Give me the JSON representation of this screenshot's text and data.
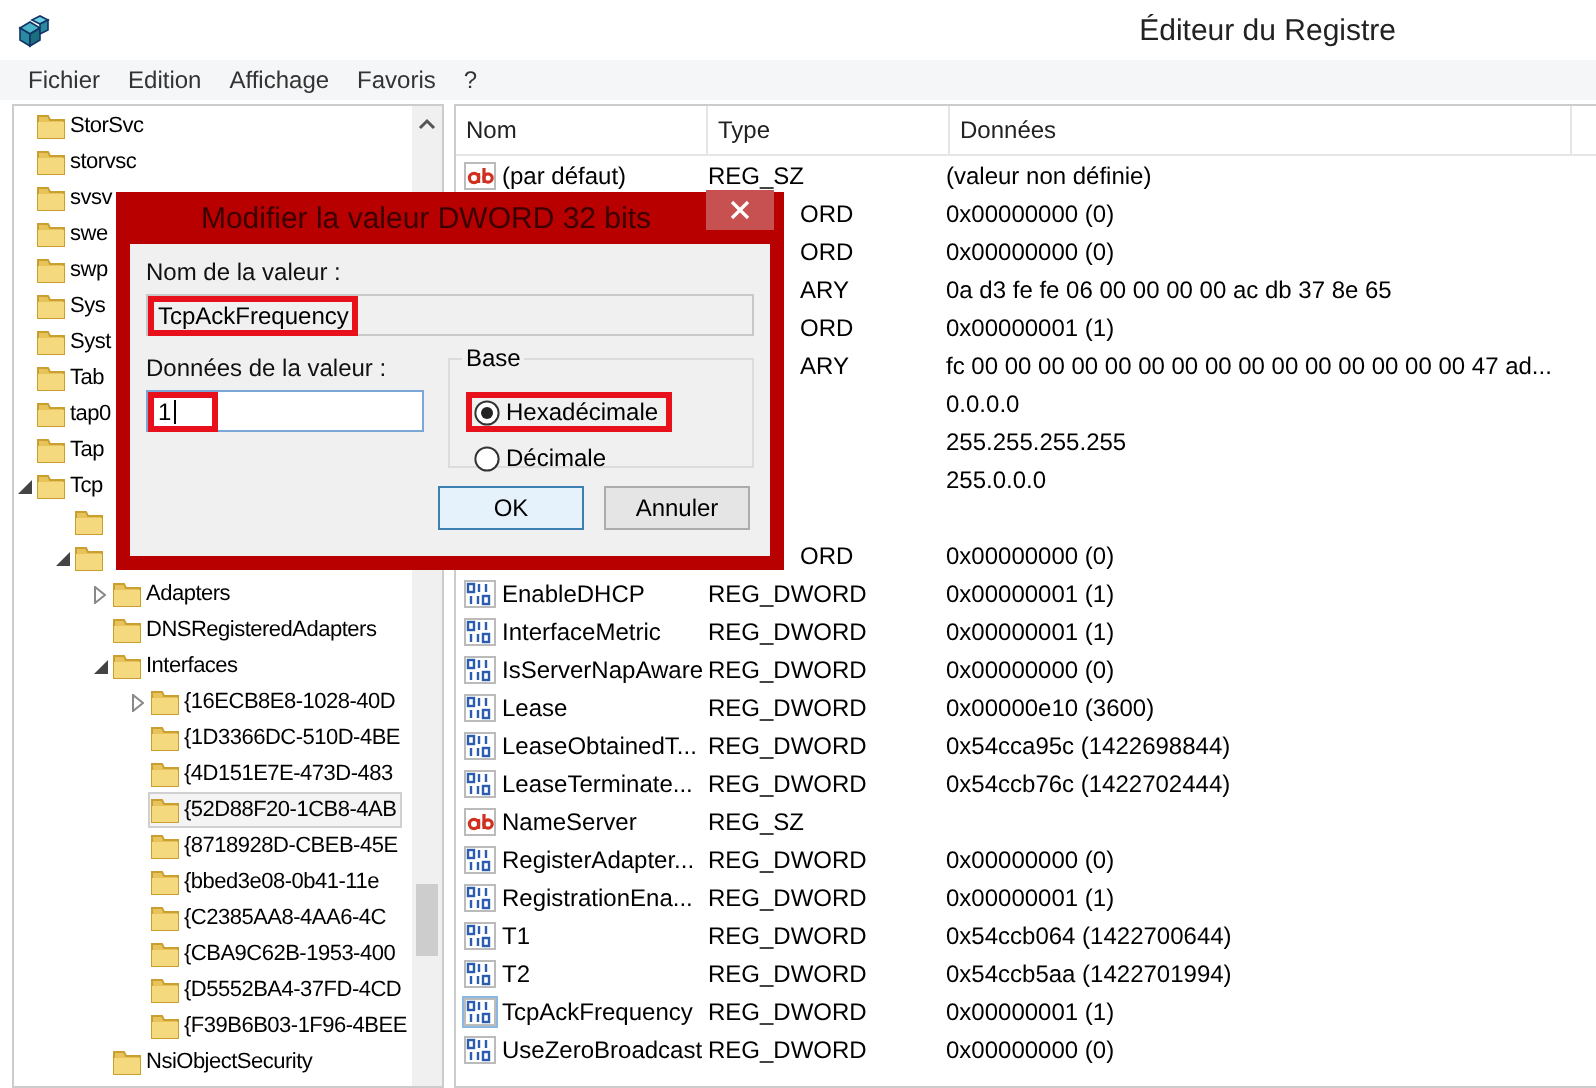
{
  "window": {
    "title": "Éditeur du Registre"
  },
  "menu": [
    "Fichier",
    "Edition",
    "Affichage",
    "Favoris",
    "?"
  ],
  "tree": [
    {
      "label": "StorSvc",
      "selected": false
    },
    {
      "label": "storvsc",
      "selected": false
    },
    {
      "label": "svsv",
      "selected": false
    },
    {
      "label": "swe",
      "selected": false
    },
    {
      "label": "swp",
      "selected": false
    },
    {
      "label": "Sys",
      "selected": false
    },
    {
      "label": "Syst",
      "selected": false
    },
    {
      "label": "Tab",
      "selected": false
    },
    {
      "label": "tap0",
      "selected": false
    },
    {
      "label": "Tap",
      "selected": false
    },
    {
      "label": "Tcp",
      "selected": false,
      "expanded": true,
      "children": [
        {
          "selected": false
        },
        {
          "selected": false,
          "expanded": true,
          "children": [
            {
              "label": "Adapters",
              "selected": false,
              "expanded": false
            },
            {
              "label": "DNSRegisteredAdapters",
              "selected": false
            },
            {
              "label": "Interfaces",
              "selected": false,
              "expanded": true,
              "children": [
                {
                  "label": "{16ECB8E8-1028-40D",
                  "selected": false,
                  "expanded": false
                },
                {
                  "label": "{1D3366DC-510D-4BE",
                  "selected": false
                },
                {
                  "label": "{4D151E7E-473D-483",
                  "selected": false
                },
                {
                  "label": "{52D88F20-1CB8-4AB",
                  "selected": true
                },
                {
                  "label": "{8718928D-CBEB-45E",
                  "selected": false
                },
                {
                  "label": "{bbed3e08-0b41-11e",
                  "selected": false
                },
                {
                  "label": "{C2385AA8-4AA6-4C",
                  "selected": false
                },
                {
                  "label": "{CBA9C62B-1953-400",
                  "selected": false
                },
                {
                  "label": "{D5552BA4-37FD-4CD",
                  "selected": false
                },
                {
                  "label": "{F39B6B03-1F96-4BEE",
                  "selected": false
                }
              ]
            },
            {
              "label": "NsiObjectSecurity",
              "selected": false
            }
          ]
        }
      ]
    }
  ],
  "list": {
    "columns": [
      "Nom",
      "Type",
      "Données"
    ],
    "rows": [
      {
        "name": "(par défaut)",
        "type": "REG_SZ",
        "data": "(valeur non définie)",
        "kind": "string",
        "selected": false
      },
      {
        "type": "ORD",
        "data": "0x00000000 (0)",
        "selected": false
      },
      {
        "type": "ORD",
        "data": "0x00000000 (0)",
        "selected": false
      },
      {
        "type": "ARY",
        "data": "0a d3 fe fe 06 00 00 00 00 ac db 37 8e 65",
        "selected": false
      },
      {
        "type": "ORD",
        "data": "0x00000001 (1)",
        "selected": false
      },
      {
        "type": "ARY",
        "data": "fc 00 00 00 00 00 00 00 00 00 00 00 00 00 00 00 47 ad...",
        "selected": false
      },
      {
        "data": "0.0.0.0",
        "selected": false
      },
      {
        "data": "255.255.255.255",
        "selected": false
      },
      {
        "data": "255.0.0.0",
        "selected": false
      },
      {
        "selected": false
      },
      {
        "type": "ORD",
        "data": "0x00000000 (0)",
        "selected": false
      },
      {
        "name": "EnableDHCP",
        "type": "REG_DWORD",
        "data": "0x00000001 (1)",
        "kind": "binary",
        "selected": false
      },
      {
        "name": "InterfaceMetric",
        "type": "REG_DWORD",
        "data": "0x00000001 (1)",
        "kind": "binary",
        "selected": false
      },
      {
        "name": "IsServerNapAware",
        "type": "REG_DWORD",
        "data": "0x00000000 (0)",
        "kind": "binary",
        "selected": false
      },
      {
        "name": "Lease",
        "type": "REG_DWORD",
        "data": "0x00000e10 (3600)",
        "kind": "binary",
        "selected": false
      },
      {
        "name": "LeaseObtainedT...",
        "type": "REG_DWORD",
        "data": "0x54cca95c (1422698844)",
        "kind": "binary",
        "selected": false
      },
      {
        "name": "LeaseTerminate...",
        "type": "REG_DWORD",
        "data": "0x54ccb76c (1422702444)",
        "kind": "binary",
        "selected": false
      },
      {
        "name": "NameServer",
        "type": "REG_SZ",
        "kind": "string",
        "selected": false
      },
      {
        "name": "RegisterAdapter...",
        "type": "REG_DWORD",
        "data": "0x00000000 (0)",
        "kind": "binary",
        "selected": false
      },
      {
        "name": "RegistrationEna...",
        "type": "REG_DWORD",
        "data": "0x00000001 (1)",
        "kind": "binary",
        "selected": false
      },
      {
        "name": "T1",
        "type": "REG_DWORD",
        "data": "0x54ccb064 (1422700644)",
        "kind": "binary",
        "selected": false
      },
      {
        "name": "T2",
        "type": "REG_DWORD",
        "data": "0x54ccb5aa (1422701994)",
        "kind": "binary",
        "selected": false
      },
      {
        "name": "TcpAckFrequency",
        "type": "REG_DWORD",
        "data": "0x00000001 (1)",
        "kind": "binary",
        "selected": true
      },
      {
        "name": "UseZeroBroadcast",
        "type": "REG_DWORD",
        "data": "0x00000000 (0)",
        "kind": "binary",
        "selected": false
      }
    ]
  },
  "dialog": {
    "title": "Modifier la valeur DWORD 32 bits",
    "name_label": "Nom de la valeur :",
    "name_value": "TcpAckFrequency",
    "name_highlighted": true,
    "data_label": "Données de la valeur :",
    "data_value": "1",
    "data_highlighted": true,
    "base_label": "Base",
    "base_options": [
      {
        "label": "Hexadécimale",
        "selected": true,
        "highlighted": true
      },
      {
        "label": "Décimale",
        "selected": false,
        "highlighted": false
      }
    ],
    "buttons": [
      {
        "label": "OK",
        "default": true
      },
      {
        "label": "Annuler",
        "default": false
      }
    ]
  }
}
